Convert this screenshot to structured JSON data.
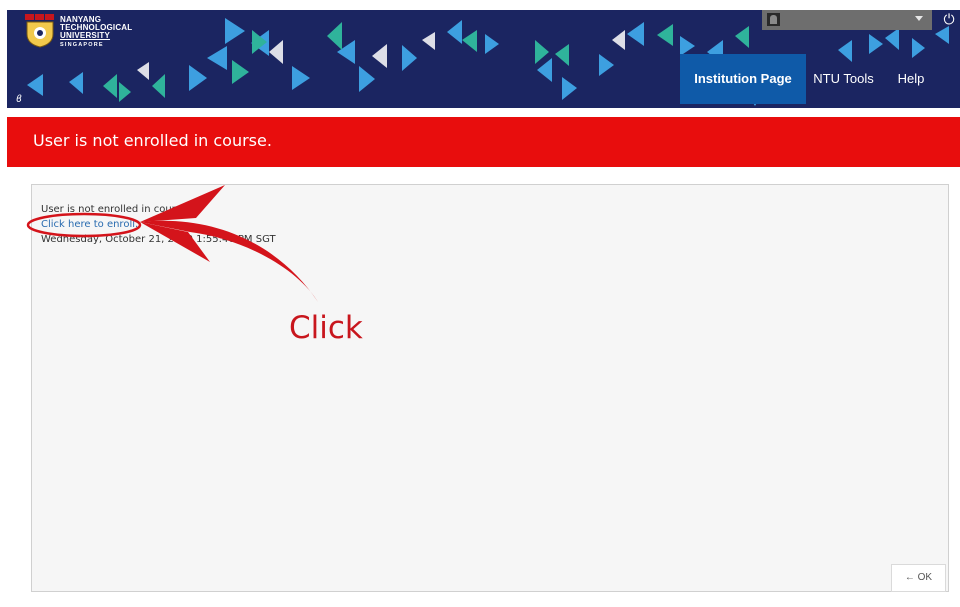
{
  "header": {
    "logo": {
      "lines": [
        "NANYANG",
        "TECHNOLOGICAL",
        "UNIVERSITY"
      ],
      "sub": "SINGAPORE",
      "crest_icon": "ntu-crest-icon"
    },
    "user_menu": {
      "avatar_icon": "user-avatar-icon",
      "dropdown_icon": "chevron-down-icon"
    },
    "power_icon": "power-icon",
    "nav": [
      {
        "label": "Institution Page",
        "active": true
      },
      {
        "label": "NTU Tools",
        "active": false
      },
      {
        "label": "Help",
        "active": false
      }
    ],
    "colors": {
      "background": "#1b2561",
      "active_tab": "#0f5aa8"
    }
  },
  "banner": {
    "text": "User is not enrolled in course.",
    "color": "#e80d0d"
  },
  "content": {
    "message": "User is not enrolled in course.",
    "enroll_link": "Click here to enroll.",
    "timestamp": "Wednesday, October 21, 2020 1:55:46 PM SGT"
  },
  "ok_button": {
    "label": "← OK"
  },
  "annotation": {
    "label": "Click",
    "color": "#c8161d"
  }
}
